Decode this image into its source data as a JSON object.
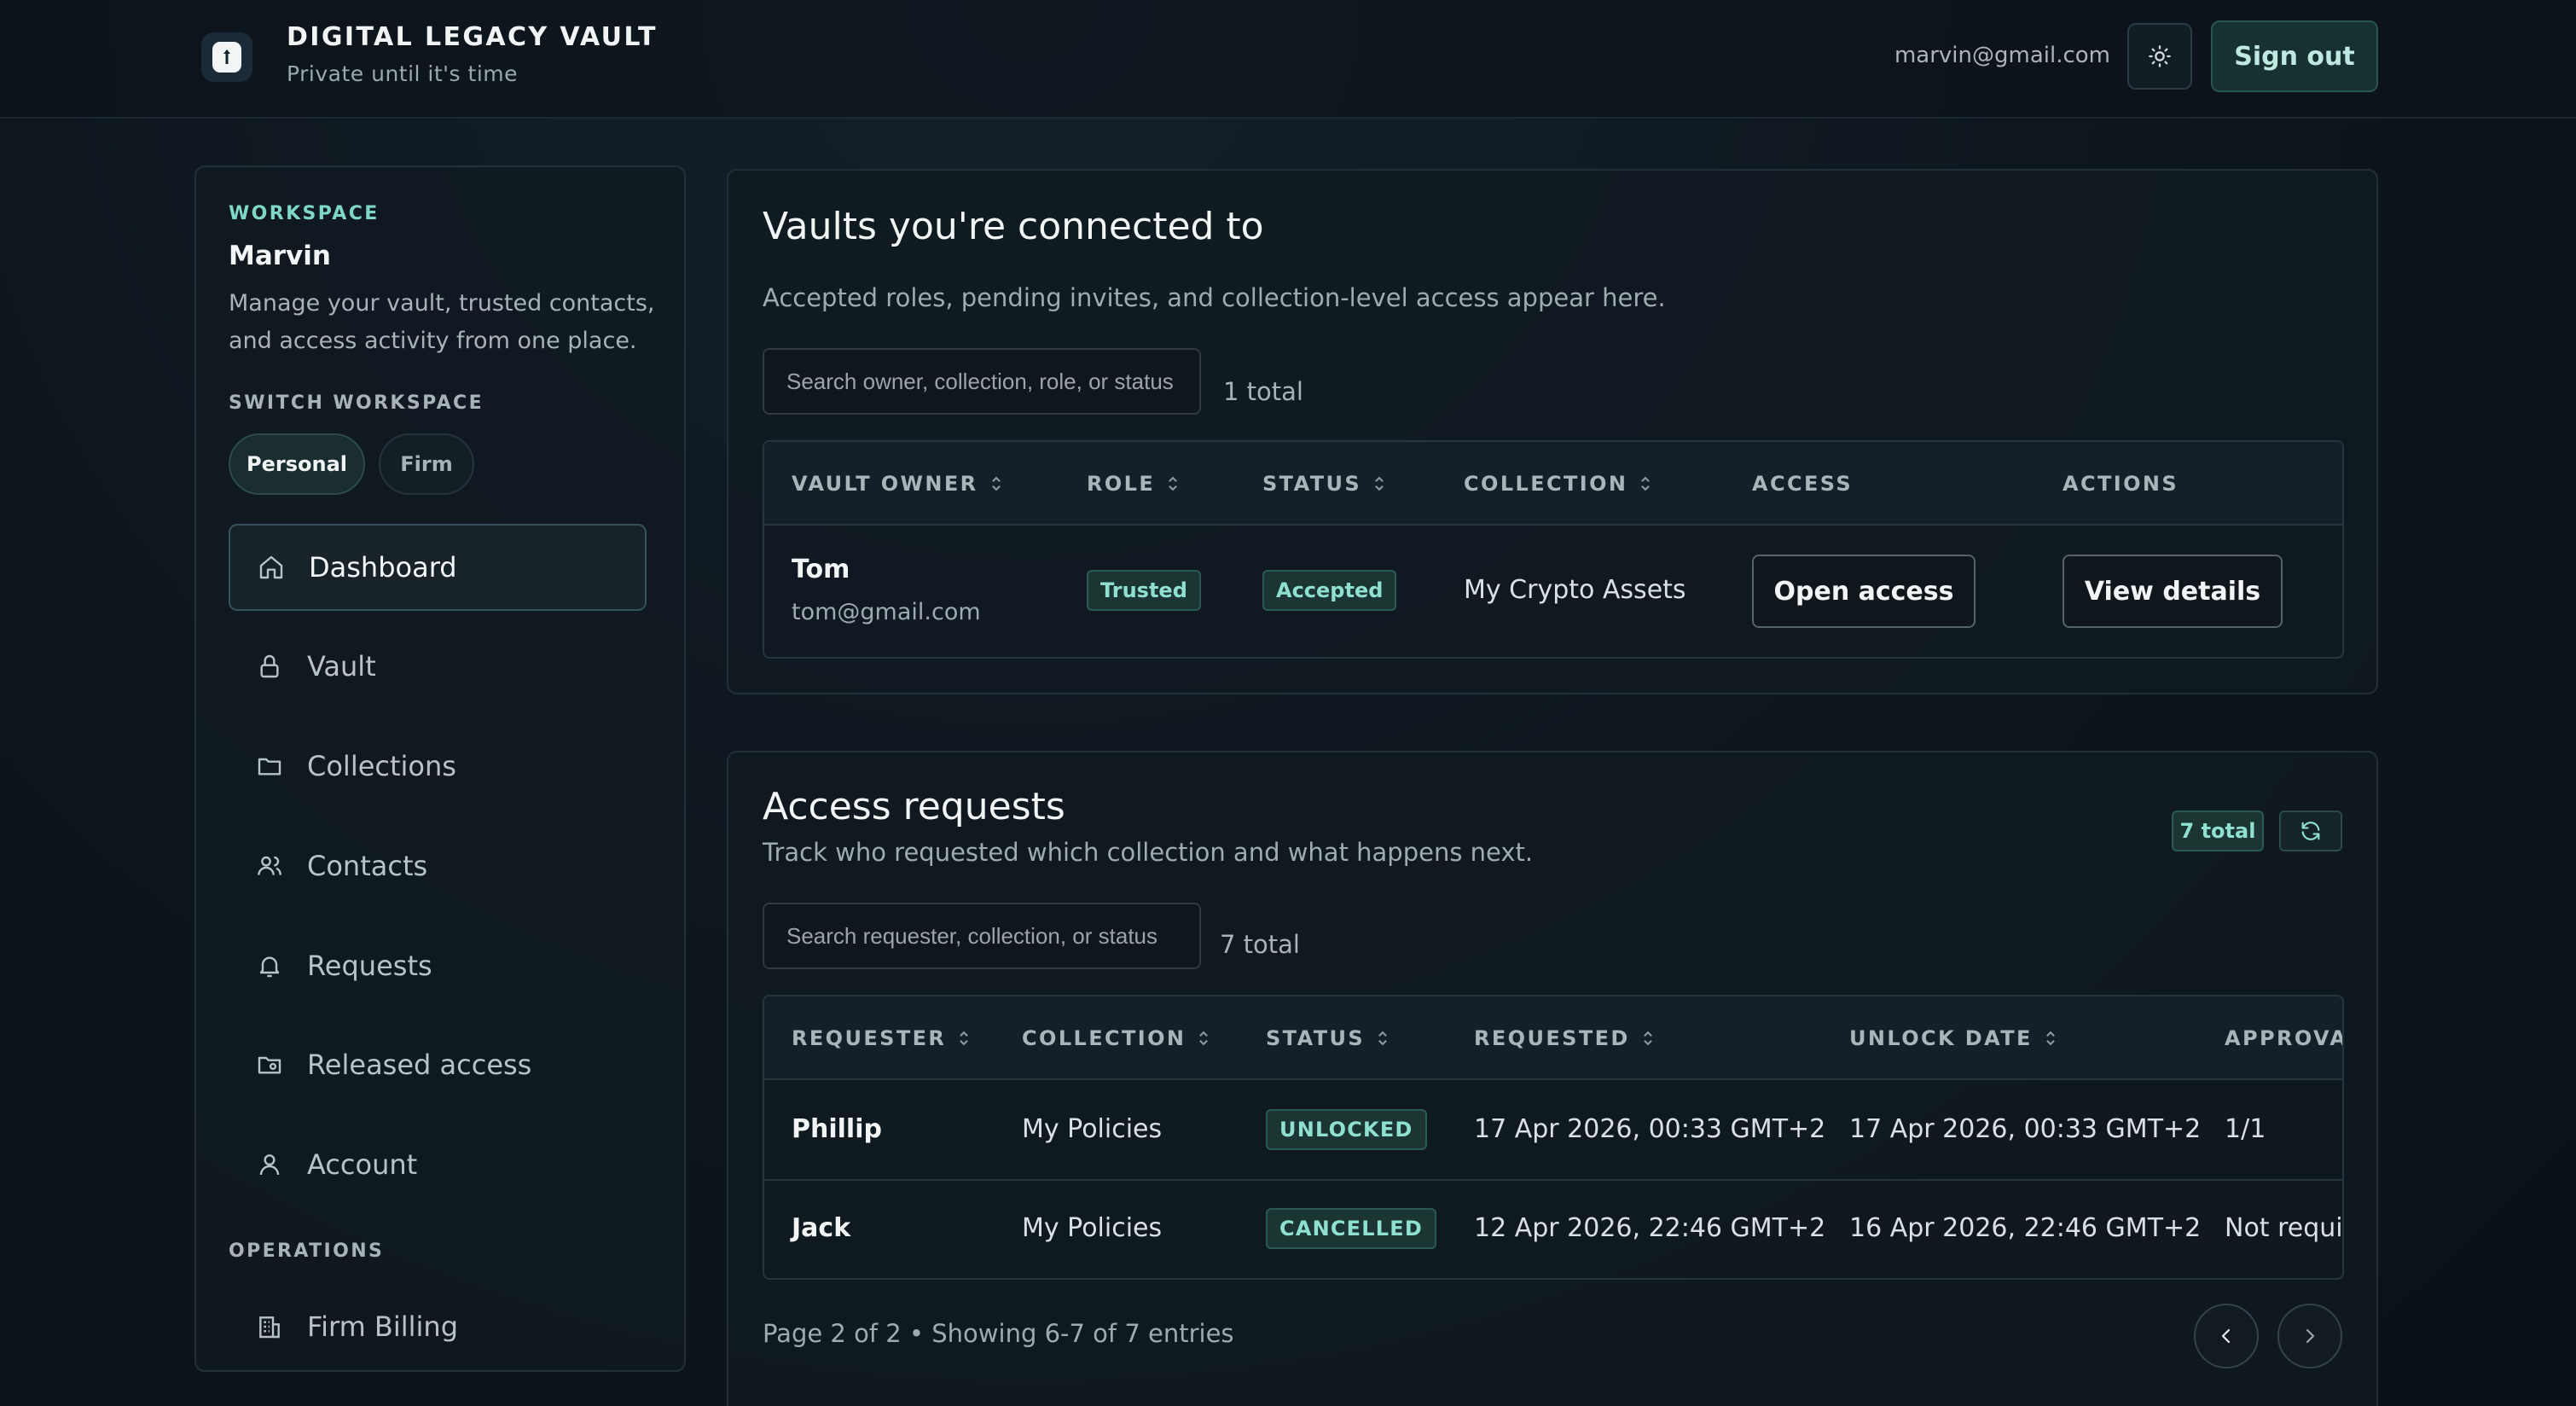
{
  "header": {
    "brand_title": "DIGITAL LEGACY VAULT",
    "brand_subtitle": "Private until it's time",
    "user_email": "marvin@gmail.com",
    "sign_out_label": "Sign out"
  },
  "sidebar": {
    "workspace_label": "WORKSPACE",
    "workspace_name": "Marvin",
    "workspace_description": "Manage your vault, trusted contacts, and access activity from one place.",
    "switch_label": "SWITCH WORKSPACE",
    "switch_options": [
      "Personal",
      "Firm"
    ],
    "nav_items": [
      {
        "label": "Dashboard",
        "icon": "home-icon",
        "active": true
      },
      {
        "label": "Vault",
        "icon": "lock-icon"
      },
      {
        "label": "Collections",
        "icon": "folder-icon"
      },
      {
        "label": "Contacts",
        "icon": "users-icon"
      },
      {
        "label": "Requests",
        "icon": "bell-icon"
      },
      {
        "label": "Released access",
        "icon": "folder-open-icon"
      },
      {
        "label": "Account",
        "icon": "user-icon"
      }
    ],
    "operations_label": "OPERATIONS",
    "operations_items": [
      {
        "label": "Firm Billing",
        "icon": "building-icon"
      }
    ]
  },
  "vaults": {
    "title": "Vaults you're connected to",
    "subtitle": "Accepted roles, pending invites, and collection-level access appear here.",
    "search_placeholder": "Search owner, collection, role, or status",
    "total": "1 total",
    "columns": [
      "VAULT OWNER",
      "ROLE",
      "STATUS",
      "COLLECTION",
      "ACCESS",
      "ACTIONS"
    ],
    "rows": [
      {
        "owner_name": "Tom",
        "owner_email": "tom@gmail.com",
        "role": "Trusted",
        "status": "Accepted",
        "collection": "My Crypto Assets",
        "access_button": "Open access",
        "actions_button": "View details"
      }
    ]
  },
  "requests": {
    "title": "Access requests",
    "subtitle": "Track who requested which collection and what happens next.",
    "count_badge": "7 total",
    "search_placeholder": "Search requester, collection, or status",
    "total": "7 total",
    "columns": [
      "REQUESTER",
      "COLLECTION",
      "STATUS",
      "REQUESTED",
      "UNLOCK DATE",
      "APPROVA"
    ],
    "rows": [
      {
        "requester": "Phillip",
        "collection": "My Policies",
        "status": "UNLOCKED",
        "requested": "17 Apr 2026, 00:33 GMT+2",
        "unlock_date": "17 Apr 2026, 00:33 GMT+2",
        "approval": "1/1"
      },
      {
        "requester": "Jack",
        "collection": "My Policies",
        "status": "CANCELLED",
        "requested": "12 Apr 2026, 22:46 GMT+2",
        "unlock_date": "16 Apr 2026, 22:46 GMT+2",
        "approval": "Not requir"
      }
    ],
    "pagination": "Page 2 of 2 • Showing 6-7 of 7 entries"
  },
  "colors": {
    "accent": "#8fe0cf",
    "background": "#0d151c",
    "panel": "#111a21"
  }
}
